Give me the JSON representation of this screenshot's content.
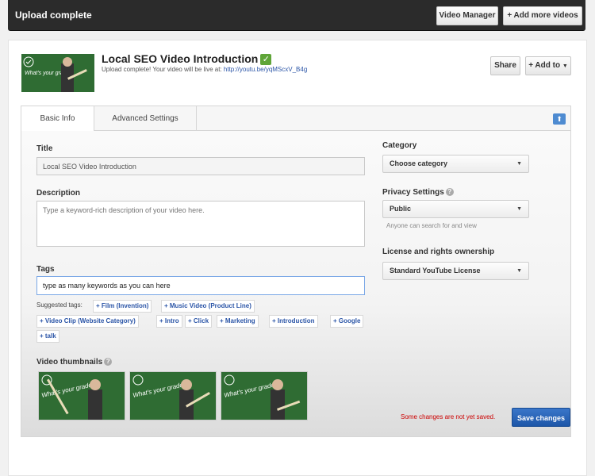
{
  "topbar": {
    "title": "Upload complete",
    "video_manager_label": "Video Manager",
    "add_more_label": "+ Add more videos"
  },
  "video": {
    "title": "Local SEO Video Introduction",
    "upload_message": "Upload complete! Your video will be live at:",
    "url": "http://youtu.be/yqMScxV_B4g",
    "share_label": "Share",
    "addto_label": "+ Add to"
  },
  "tabs": [
    {
      "label": "Basic Info",
      "active": true
    },
    {
      "label": "Advanced Settings",
      "active": false
    }
  ],
  "form": {
    "title_label": "Title",
    "title_value": "Local SEO Video Introduction",
    "description_label": "Description",
    "description_placeholder": "Type a keyword-rich description of your video here.",
    "tags_label": "Tags",
    "tags_value": "type as many keywords as you can here",
    "suggested_label": "Suggested tags:",
    "suggested_tags": [
      "+ Film (Invention)",
      "+ Music Video (Product Line)",
      "+ Video Clip (Website Category)",
      "+ Intro",
      "+ Click",
      "+ Marketing",
      "+ Introduction",
      "+ Google",
      "+ talk"
    ],
    "thumbnails_label": "Video thumbnails",
    "category_label": "Category",
    "category_value": "Choose category",
    "privacy_label": "Privacy Settings",
    "privacy_value": "Public",
    "privacy_hint": "Anyone can search for and view",
    "license_label": "License and rights ownership",
    "license_value": "Standard YouTube License"
  },
  "footer": {
    "unsaved_message": "Some changes are not yet saved.",
    "save_label": "Save changes"
  },
  "colors": {
    "accent": "#1d56a8",
    "check": "#5fa538",
    "link": "#2b55a7",
    "warning": "#cc0000"
  }
}
